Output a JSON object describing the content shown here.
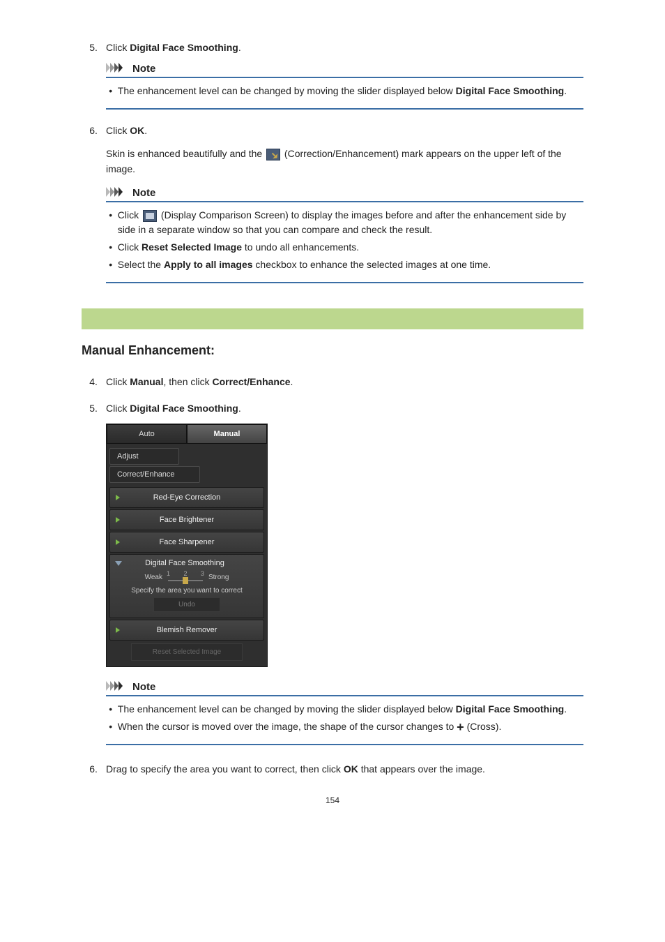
{
  "step5": {
    "num": "5.",
    "pre": "Click ",
    "bold": "Digital Face Smoothing",
    "post": "."
  },
  "note1": {
    "title": "Note",
    "item_pre": "The enhancement level can be changed by moving the slider displayed below ",
    "item_bold": "Digital Face Smoothing",
    "item_post": "."
  },
  "step6": {
    "num": "6.",
    "pre": "Click ",
    "bold": "OK",
    "post": ".",
    "desc_pre": "Skin is enhanced beautifully and the ",
    "desc_post": " (Correction/Enhancement) mark appears on the upper left of the image."
  },
  "note2": {
    "title": "Note",
    "i1_pre": "Click ",
    "i1_post": " (Display Comparison Screen) to display the images before and after the enhancement side by side in a separate window so that you can compare and check the result.",
    "i2_pre": "Click ",
    "i2_bold": "Reset Selected Image",
    "i2_post": " to undo all enhancements.",
    "i3_pre": "Select the ",
    "i3_bold": "Apply to all images",
    "i3_post": " checkbox to enhance the selected images at one time."
  },
  "manual": {
    "heading": "Manual Enhancement:",
    "s4_num": "4.",
    "s4_pre": "Click ",
    "s4_b1": "Manual",
    "s4_mid": ", then click ",
    "s4_b2": "Correct/Enhance",
    "s4_post": ".",
    "s5_num": "5.",
    "s5_pre": "Click ",
    "s5_bold": "Digital Face Smoothing",
    "s5_post": "."
  },
  "panel": {
    "tab_auto": "Auto",
    "tab_manual": "Manual",
    "sub_adjust": "Adjust",
    "sub_ce": "Correct/Enhance",
    "item_redeye": "Red-Eye Correction",
    "item_brighten": "Face Brightener",
    "item_sharpen": "Face Sharpener",
    "item_smooth": "Digital Face Smoothing",
    "item_blemish": "Blemish Remover",
    "slider_weak": "Weak",
    "slider_strong": "Strong",
    "slider_1": "1",
    "slider_2": "2",
    "slider_3": "3",
    "specify": "Specify the area you want to correct",
    "undo": "Undo",
    "reset": "Reset Selected Image"
  },
  "note3": {
    "title": "Note",
    "i1_pre": "The enhancement level can be changed by moving the slider displayed below ",
    "i1_bold": "Digital Face Smoothing",
    "i1_post": ".",
    "i2_pre": "When the cursor is moved over the image, the shape of the cursor changes to ",
    "i2_post": " (Cross)."
  },
  "step6b": {
    "num": "6.",
    "pre": "Drag to specify the area you want to correct, then click ",
    "bold": "OK",
    "post": " that appears over the image."
  },
  "page_number": "154"
}
